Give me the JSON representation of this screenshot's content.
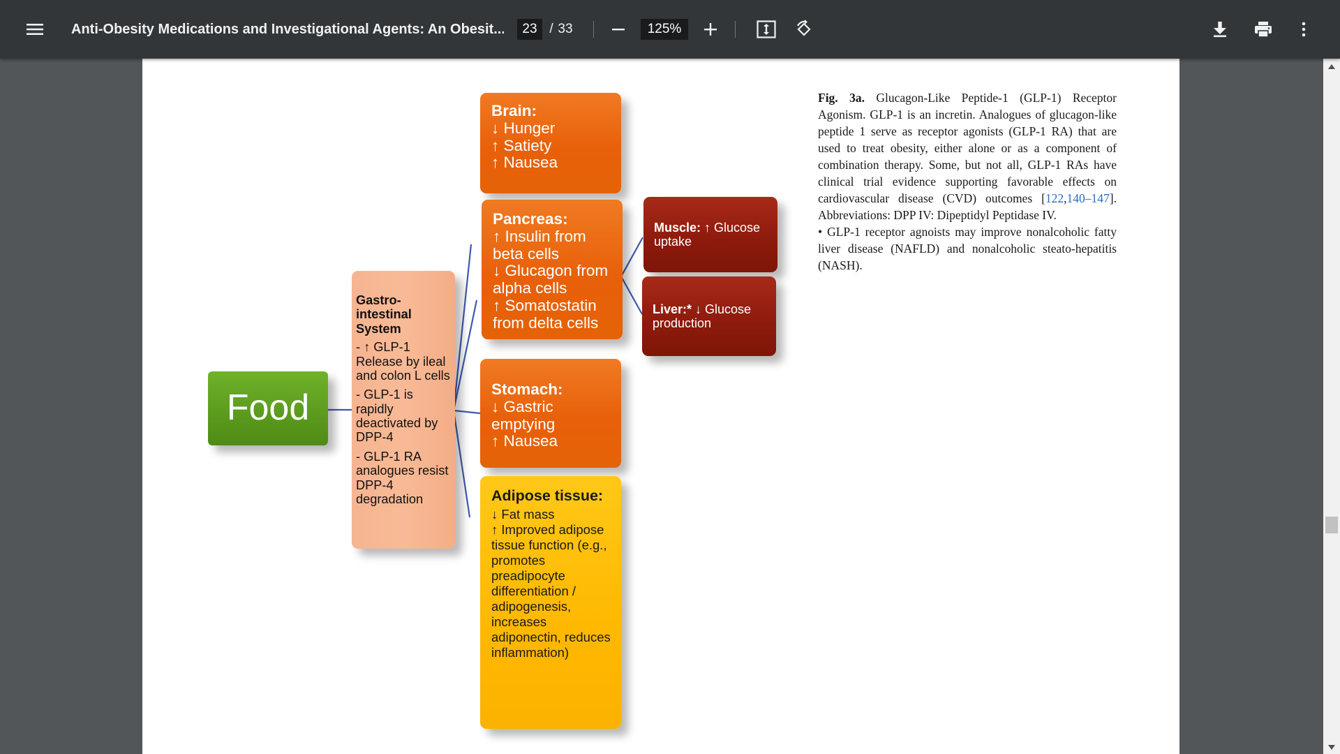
{
  "toolbar": {
    "menu_icon": "hamburger-menu-icon",
    "title": "Anti-Obesity Medications and Investigational Agents: An Obesit...",
    "page_current": "23",
    "page_separator": "/",
    "page_total": "33",
    "zoom_level": "125%",
    "icons": [
      "minus-icon",
      "plus-icon",
      "fit-to-page-icon",
      "rotate-icon",
      "download-icon",
      "print-icon",
      "more-vertical-icon"
    ]
  },
  "figure": {
    "food": "Food",
    "gi": {
      "heading": "Gastro-intestinal System",
      "line1": "- ↑ GLP-1 Release by ileal and colon L cells",
      "line2": "- GLP-1 is rapidly deactivated by DPP-4",
      "line3": "- GLP-1 RA analogues resist DPP-4 degradation"
    },
    "brain": {
      "heading": "Brain:",
      "l1": "↓ Hunger",
      "l2": "↑ Satiety",
      "l3": "↑ Nausea"
    },
    "pancreas": {
      "heading": "Pancreas:",
      "l1": "↑ Insulin from beta cells",
      "l2": "↓ Glucagon from alpha cells",
      "l3": "↑ Somatostatin from delta cells"
    },
    "stomach": {
      "heading": "Stomach:",
      "l1": "↓ Gastric emptying",
      "l2": "↑ Nausea"
    },
    "adipose": {
      "heading": "Adipose tissue:",
      "l1": "↓ Fat mass",
      "l2": "↑ Improved adipose tissue function (e.g., promotes preadipocyte differentiation / adipogenesis, increases adiponectin, reduces inflammation)"
    },
    "muscle": {
      "heading": "Muscle:",
      "rest": " ↑ Glucose uptake"
    },
    "liver": {
      "heading": "Liver:*",
      "rest": " ↓ Glucose production"
    }
  },
  "caption": {
    "label": "Fig. 3a.",
    "text1": " Glucagon-Like Peptide-1 (GLP-1) Receptor Agonism. GLP-1 is an incretin. Analogues of glucagon-like peptide 1 serve as receptor agonists (GLP-1 RA) that are used to treat obesity, either alone or as a component of combination therapy. Some, but not all, GLP-1 RAs have clinical trial evidence supporting favorable effects on cardiovascular disease (CVD) outcomes [",
    "ref1": "122",
    "ref_sep": ",",
    "ref2": "140–147",
    "text2": "]. Abbreviations: DPP IV: Dipeptidyl Peptidase IV.",
    "bullet": "• GLP-1 receptor agnoists may improve nonalcoholic fatty liver disease (NAFLD) and nonalcoholic steato-hepatitis (NASH)."
  }
}
